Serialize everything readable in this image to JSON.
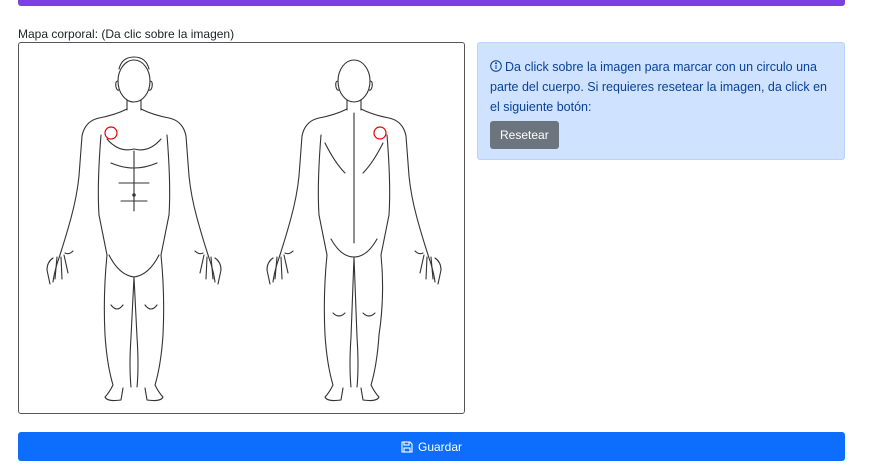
{
  "form": {
    "body_map_label": "Mapa corporal: (Da clic sobre la imagen)",
    "info": {
      "text": "Da click sobre la imagen para marcar con un circulo una parte del cuerpo. Si requieres resetear la imagen, da click en el siguiente botón:",
      "icon": "info-circle-icon",
      "reset_label": "Resetear"
    },
    "save_label": "Guardar",
    "save_icon": "floppy-disk-icon"
  },
  "colors": {
    "accent_bar": "#7b3fe4",
    "info_background": "#cfe2ff",
    "info_text": "#084298",
    "reset_button": "#6c757d",
    "save_button": "#0d6efd",
    "marker": "#e00000"
  },
  "markers": [
    {
      "figure": "front",
      "region": "right chest"
    },
    {
      "figure": "back",
      "region": "left shoulder blade"
    }
  ]
}
